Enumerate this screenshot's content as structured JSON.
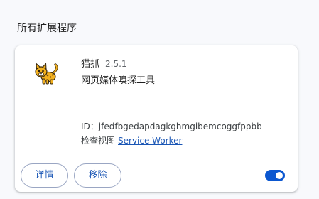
{
  "section": {
    "title": "所有扩展程序"
  },
  "extension": {
    "name": "猫抓",
    "version": "2.5.1",
    "description": "网页媒体嗅探工具",
    "id_text": "ID：jfedfbgedapdagkghmgibemcoggfppbb",
    "inspect_label": "检查视图",
    "inspect_link": "Service Worker",
    "icon": "cat-icon",
    "enabled": true
  },
  "buttons": {
    "details_label": "详情",
    "remove_label": "移除"
  },
  "colors": {
    "accent": "#0b57d0",
    "link": "#1a56b5",
    "background": "#f8f9fc",
    "card": "#ffffff"
  }
}
